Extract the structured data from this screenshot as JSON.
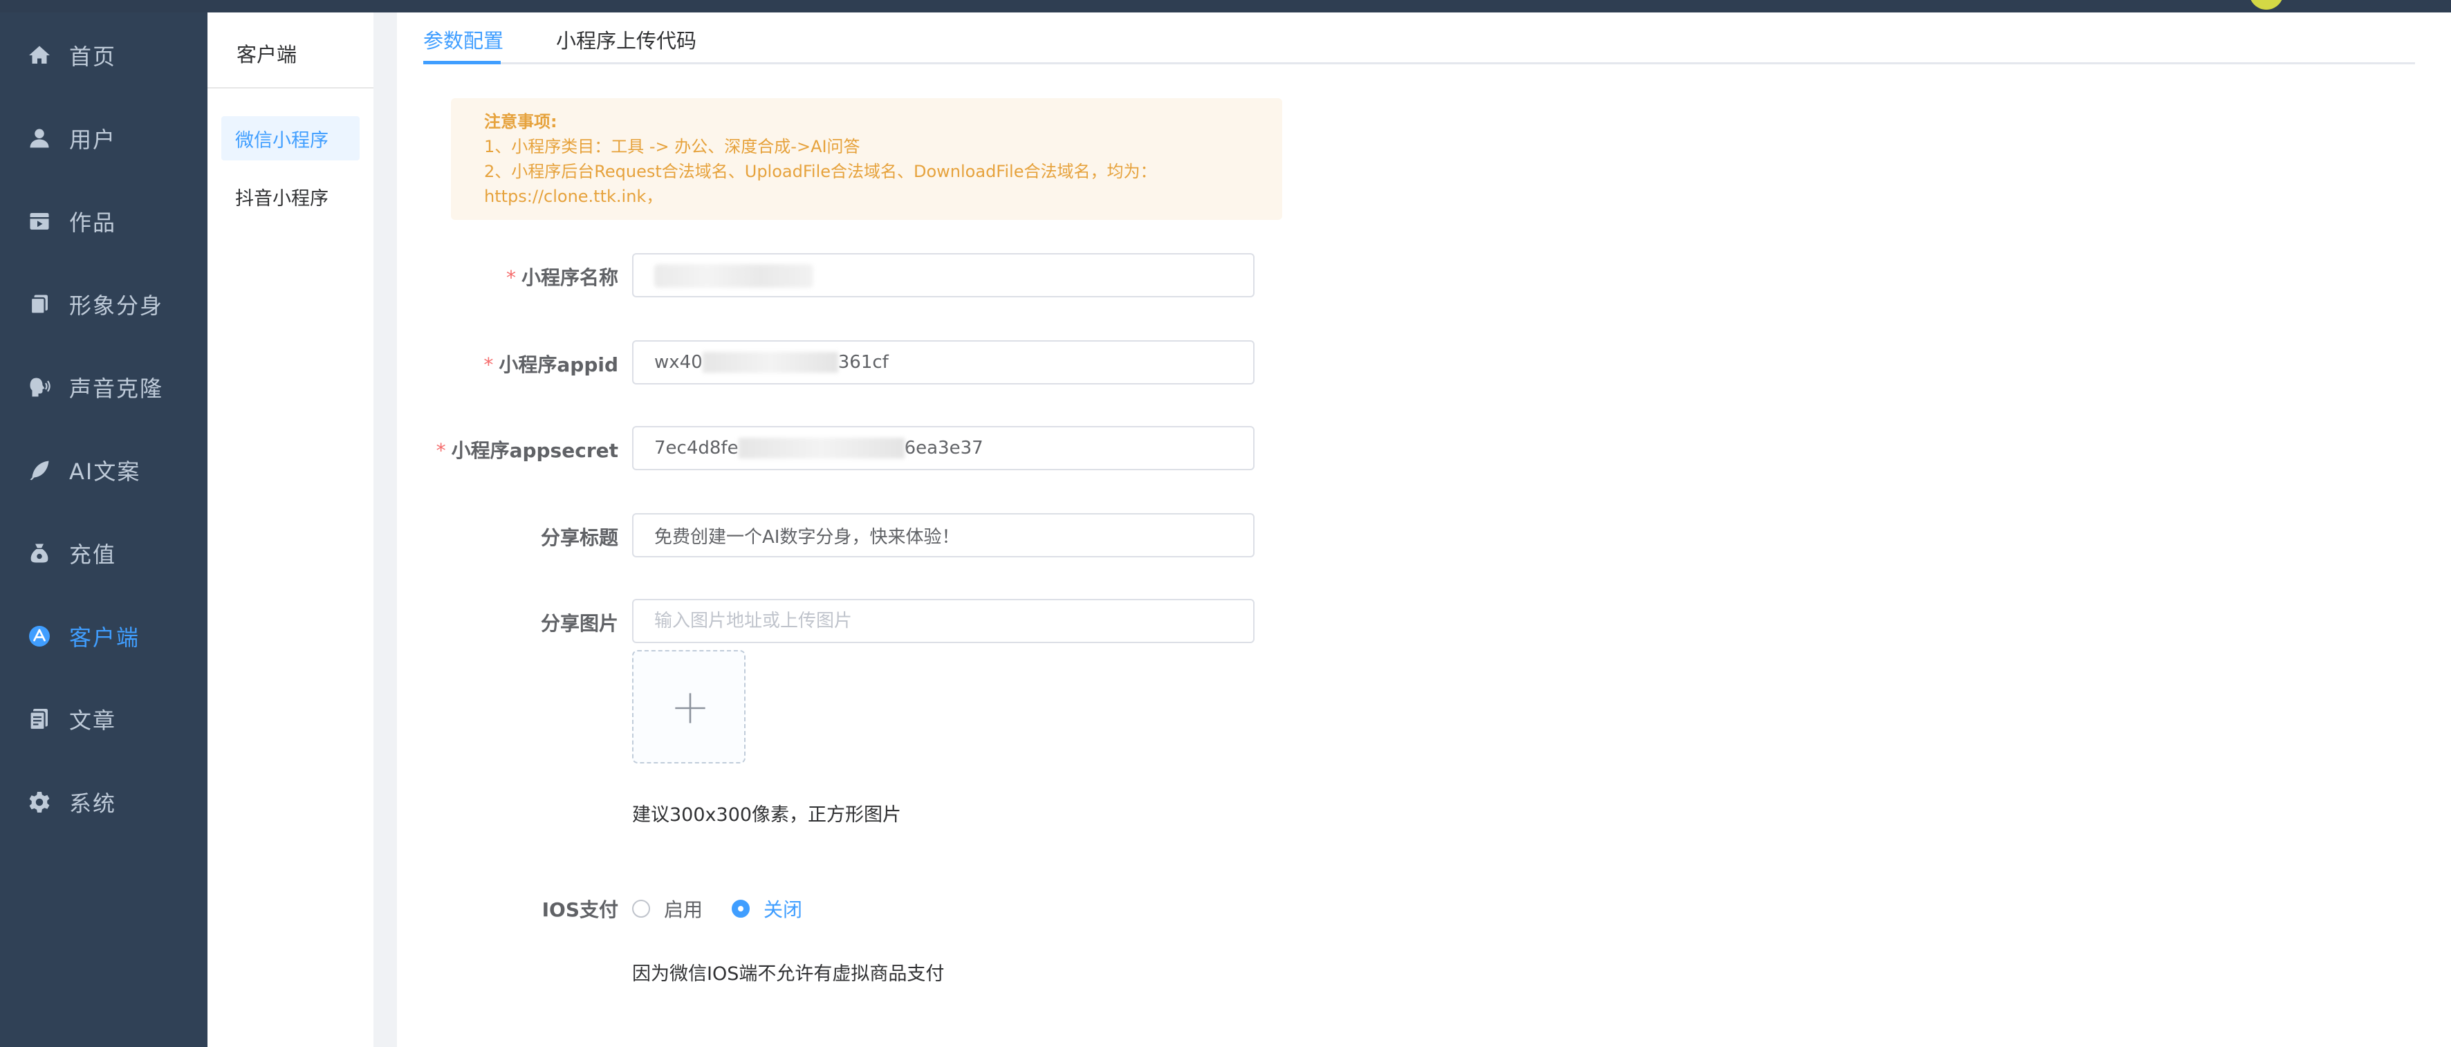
{
  "sidebar": {
    "items": [
      {
        "label": "首页",
        "icon": "home-icon"
      },
      {
        "label": "用户",
        "icon": "user-icon"
      },
      {
        "label": "作品",
        "icon": "video-icon"
      },
      {
        "label": "形象分身",
        "icon": "copy-icon"
      },
      {
        "label": "声音克隆",
        "icon": "voice-icon"
      },
      {
        "label": "AI文案",
        "icon": "feather-icon"
      },
      {
        "label": "充值",
        "icon": "money-bag-icon"
      },
      {
        "label": "客户端",
        "icon": "app-store-icon"
      },
      {
        "label": "文章",
        "icon": "document-icon"
      },
      {
        "label": "系统",
        "icon": "gear-icon"
      }
    ],
    "active_index": 7
  },
  "subnav": {
    "title": "客户端",
    "items": [
      {
        "label": "微信小程序"
      },
      {
        "label": "抖音小程序"
      }
    ]
  },
  "tabs": [
    {
      "label": "参数配置"
    },
    {
      "label": "小程序上传代码"
    }
  ],
  "notice": {
    "title": "注意事项:",
    "line1": "1、小程序类目：工具 -> 办公、深度合成->AI问答",
    "line2": "2、小程序后台Request合法域名、UploadFile合法域名、DownloadFile合法域名，均为：",
    "line3": "https://clone.ttk.ink，"
  },
  "form": {
    "name_label": "小程序名称",
    "name_value": "",
    "appid_label": "小程序appid",
    "appid_value": "wx40",
    "appid_suffix": "361cf",
    "secret_label": "小程序appsecret",
    "secret_value": "7ec4d8fe",
    "secret_suffix": "6ea3e37",
    "share_title_label": "分享标题",
    "share_title_value": "免费创建一个AI数字分身，快来体验！",
    "share_image_label": "分享图片",
    "share_image_placeholder": "输入图片地址或上传图片",
    "share_image_hint": "建议300x300像素，正方形图片",
    "ios_pay_label": "IOS支付",
    "ios_options": [
      "启用",
      "关闭"
    ],
    "ios_selected": "关闭",
    "ios_hint": "因为微信IOS端不允许有虚拟商品支付"
  },
  "colors": {
    "sidebar_bg": "#304156",
    "accent": "#409eff",
    "notice_text": "#e6a23c",
    "notice_bg": "#fdf6ec",
    "required": "#f56c6c"
  }
}
